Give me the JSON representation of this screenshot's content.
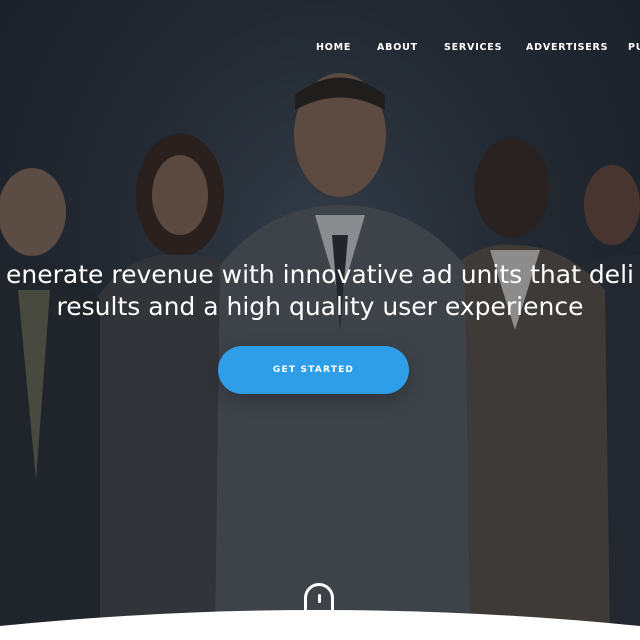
{
  "nav": {
    "items": [
      {
        "label": "HOME"
      },
      {
        "label": "ABOUT"
      },
      {
        "label": "SERVICES"
      },
      {
        "label": "ADVERTISERS"
      },
      {
        "label": "PU"
      }
    ]
  },
  "hero": {
    "headline_line1": "enerate revenue with innovative ad units that deli",
    "headline_line2": "results and a high quality user experience",
    "cta_label": "GET STARTED"
  },
  "colors": {
    "accent": "#2e9ee8",
    "overlay": "#1f262e",
    "text": "#ffffff"
  },
  "icons": {
    "scroll": "mouse-scroll-icon"
  }
}
